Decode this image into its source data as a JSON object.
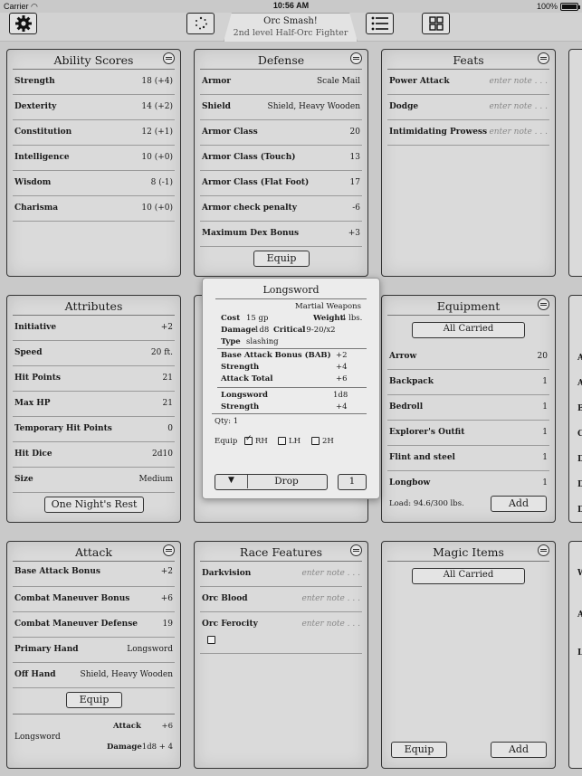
{
  "status": {
    "carrier": "Carrier",
    "time": "10:56 AM",
    "battery": "100%"
  },
  "header": {
    "title": "Orc Smash!",
    "subtitle": "2nd level Half-Orc Fighter"
  },
  "ability": {
    "title": "Ability Scores",
    "rows": [
      [
        "Strength",
        "18 (+4)"
      ],
      [
        "Dexterity",
        "14 (+2)"
      ],
      [
        "Constitution",
        "12 (+1)"
      ],
      [
        "Intelligence",
        "10 (+0)"
      ],
      [
        "Wisdom",
        "8 (-1)"
      ],
      [
        "Charisma",
        "10 (+0)"
      ]
    ]
  },
  "defense": {
    "title": "Defense",
    "rows": [
      [
        "Armor",
        "Scale Mail"
      ],
      [
        "Shield",
        "Shield, Heavy Wooden"
      ],
      [
        "Armor Class",
        "20"
      ],
      [
        "Armor Class (Touch)",
        "13"
      ],
      [
        "Armor Class (Flat Foot)",
        "17"
      ],
      [
        "Armor check penalty",
        "-6"
      ],
      [
        "Maximum Dex Bonus",
        "+3"
      ]
    ],
    "button": "Equip"
  },
  "feats": {
    "title": "Feats",
    "rows": [
      [
        "Power Attack",
        "enter note . . ."
      ],
      [
        "Dodge",
        "enter note . . ."
      ],
      [
        "Intimidating Prowess",
        "enter note . . ."
      ]
    ]
  },
  "attributes": {
    "title": "Attributes",
    "rows": [
      [
        "Initiative",
        "+2"
      ],
      [
        "Speed",
        "20 ft."
      ],
      [
        "Hit Points",
        "21"
      ],
      [
        "Max HP",
        "21"
      ],
      [
        "Temporary Hit Points",
        "0"
      ],
      [
        "Hit Dice",
        "2d10"
      ],
      [
        "Size",
        "Medium"
      ]
    ],
    "button": "One Night's Rest"
  },
  "equipment": {
    "title": "Equipment",
    "filter": "All Carried",
    "rows": [
      [
        "Arrow",
        "20"
      ],
      [
        "Backpack",
        "1"
      ],
      [
        "Bedroll",
        "1"
      ],
      [
        "Explorer's Outfit",
        "1"
      ],
      [
        "Flint and steel",
        "1"
      ],
      [
        "Longbow",
        "1"
      ]
    ],
    "load": "Load:  94.6/300 lbs.",
    "add": "Add"
  },
  "attack": {
    "title": "Attack",
    "rows": [
      [
        "Base Attack Bonus",
        "+2"
      ],
      [
        "Combat Maneuver Bonus",
        "+6"
      ],
      [
        "Combat Maneuver Defense",
        "19"
      ],
      [
        "Primary Hand",
        "Longsword"
      ],
      [
        "Off Hand",
        "Shield, Heavy Wooden"
      ]
    ],
    "button": "Equip",
    "weapon": "Longsword",
    "attack_label": "Attack",
    "attack_value": "+6",
    "damage_label": "Damage",
    "damage_value": "1d8 + 4"
  },
  "race": {
    "title": "Race Features",
    "rows": [
      [
        "Darkvision",
        "enter note . . ."
      ],
      [
        "Orc Blood",
        "enter note . . ."
      ],
      [
        "Orc Ferocity",
        "enter note . . ."
      ]
    ]
  },
  "magic": {
    "title": "Magic Items",
    "filter": "All Carried",
    "equip": "Equip",
    "add": "Add"
  },
  "popup": {
    "title": "Longsword",
    "category": "Martial Weapons",
    "cost_label": "Cost",
    "cost": "15 gp",
    "weight_label": "Weight",
    "weight": "4 lbs.",
    "damage_label": "Damage",
    "damage": "1d8",
    "critical_label": "Critical",
    "critical": "19-20/x2",
    "type_label": "Type",
    "type": "slashing",
    "bab_label": "Base Attack Bonus (BAB)",
    "bab": "+2",
    "str_label": "Strength",
    "str": "+4",
    "total_label": "Attack Total",
    "total": "+6",
    "dmg_weapon_label": "Longsword",
    "dmg_weapon": "1d8",
    "dmg_str_label": "Strength",
    "dmg_str": "+4",
    "qty": "Qty:  1",
    "equip_label": "Equip",
    "rh": "RH",
    "lh": "LH",
    "h2": "2H",
    "drop": "Drop",
    "drop_qty": "1"
  },
  "edge": {
    "letters": [
      "A",
      "A",
      "B",
      "C",
      "D",
      "D",
      "D",
      "E"
    ],
    "letters2": [
      "W",
      "A",
      "L"
    ]
  }
}
